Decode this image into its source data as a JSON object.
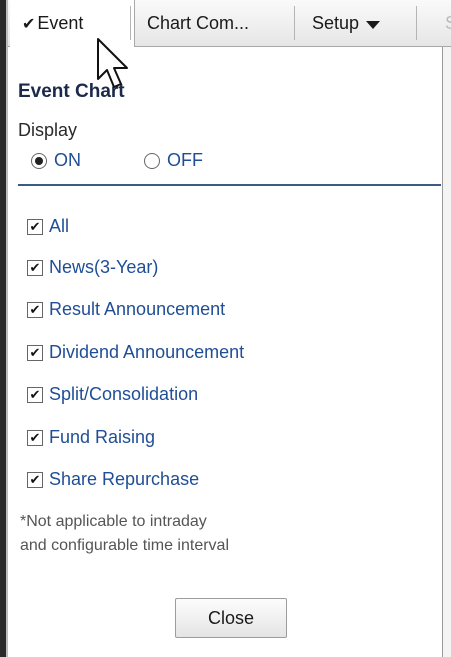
{
  "toolbar": {
    "event_check": "✔",
    "event_label": "Event",
    "chart_label": "Chart Com...",
    "setup_label": "Setup",
    "more_label": "S"
  },
  "panel": {
    "title": "Event Chart",
    "display_label": "Display",
    "radio_on_label": "ON",
    "radio_off_label": "OFF",
    "selected": "ON",
    "items": [
      {
        "label": "All",
        "checked": true
      },
      {
        "label": "News(3-Year)",
        "checked": true
      },
      {
        "label": "Result Announcement",
        "checked": true
      },
      {
        "label": "Dividend Announcement",
        "checked": true
      },
      {
        "label": "Split/Consolidation",
        "checked": true
      },
      {
        "label": "Fund Raising",
        "checked": true
      },
      {
        "label": "Share Repurchase",
        "checked": true
      }
    ],
    "note_line1": "*Not applicable to intraday",
    "note_line2": "and configurable time interval",
    "close_label": "Close",
    "check_glyph": "✔"
  },
  "colors": {
    "text_blue": "#1f4e96",
    "title_navy": "#1c2a4a",
    "rule_blue": "#3b5a86"
  },
  "icons": {
    "cursor": "mouse-pointer-icon",
    "setup_caret": "caret-down-icon"
  }
}
